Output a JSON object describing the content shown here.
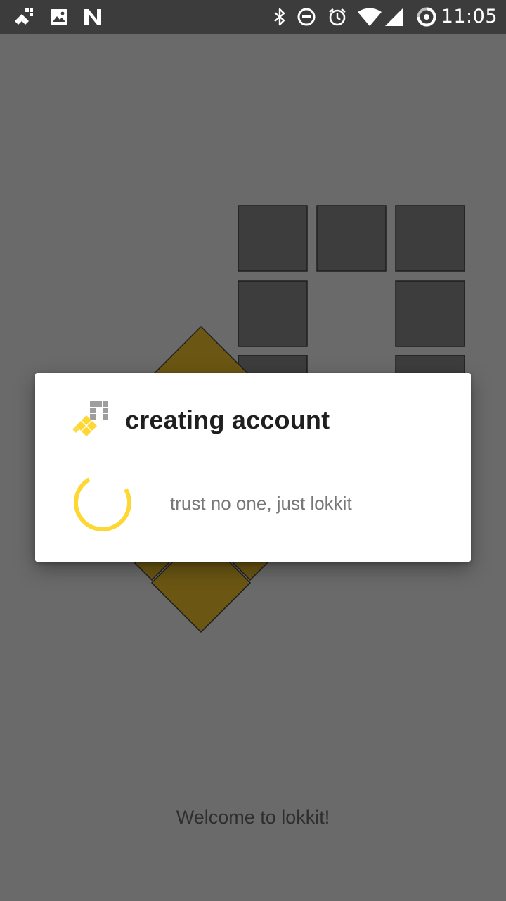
{
  "status_bar": {
    "time": "11:05",
    "left_icons": [
      "lokkit-notification-icon",
      "image-icon",
      "n-notification-icon"
    ],
    "right_icons": [
      "bluetooth-icon",
      "do-not-disturb-icon",
      "alarm-icon",
      "wifi-icon",
      "signal-icon",
      "battery-charging-icon"
    ]
  },
  "background": {
    "welcome_text": "Welcome to lokkit!",
    "colors": {
      "gray_tile": "#3d3d3d",
      "gold_tile": "#6b5613",
      "scrim_background": "#6a6a6a"
    }
  },
  "dialog": {
    "title": "creating account",
    "message": "trust no one, just lokkit",
    "accent_color": "#fdd835"
  }
}
